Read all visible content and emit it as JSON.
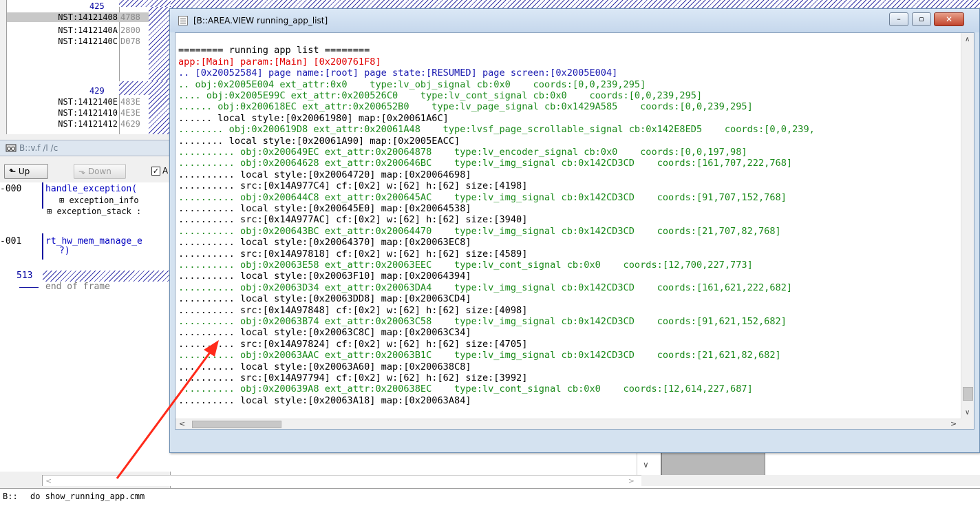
{
  "memory_dump": {
    "rows": [
      {
        "line": "425"
      },
      {
        "addr": "NST:14121408",
        "val": "4788",
        "highlight": true
      },
      {
        "addr": "NST:1412140A",
        "val": "2800"
      },
      {
        "addr": "NST:1412140C",
        "val": "D078"
      },
      {
        "line": "429"
      },
      {
        "addr": "NST:1412140E",
        "val": "483E"
      },
      {
        "addr": "NST:14121410",
        "val": "4E3E"
      },
      {
        "addr": "NST:14121412",
        "val": "4629"
      }
    ]
  },
  "frame_window": {
    "title": "B::v.f /l /c",
    "up_label": "Up",
    "down_label": "Down",
    "checkbox_label": "A",
    "checkbox_checked": "✓",
    "frames": [
      {
        "level": "-000",
        "func": "handle_exception(",
        "children": [
          "⊞ exception_info",
          "⊞ exception_stack :"
        ]
      },
      {
        "level": "-001",
        "func": "rt_hw_mem_manage_e",
        "tail": "?)"
      }
    ],
    "end_line": "513",
    "end_text": "end of frame"
  },
  "area_window": {
    "title": "[B::AREA.VIEW running_app_list]",
    "lines": [
      {
        "c": "black",
        "t": ""
      },
      {
        "c": "black",
        "t": "======== running app list ========"
      },
      {
        "c": "red",
        "t": "app:[Main] param:[Main] [0x200761F8]"
      },
      {
        "c": "blue",
        "t": ".. [0x20052584] page name:[root] page state:[RESUMED] page screen:[0x2005E004]"
      },
      {
        "c": "green",
        "t": ".. obj:0x2005E004 ext_attr:0x0    type:lv_obj_signal cb:0x0    coords:[0,0,239,295]"
      },
      {
        "c": "green",
        "t": ".... obj:0x2005E99C ext_attr:0x200526C0    type:lv_cont_signal cb:0x0    coords:[0,0,239,295]"
      },
      {
        "c": "green",
        "t": "...... obj:0x200618EC ext_attr:0x200652B0    type:lv_page_signal cb:0x1429A585    coords:[0,0,239,295]"
      },
      {
        "c": "black",
        "t": "...... local style:[0x20061980] map:[0x20061A6C]"
      },
      {
        "c": "green",
        "t": "........ obj:0x200619D8 ext_attr:0x20061A48    type:lvsf_page_scrollable_signal cb:0x142E8ED5    coords:[0,0,239,"
      },
      {
        "c": "black",
        "t": "........ local style:[0x20061A90] map:[0x2005EACC]"
      },
      {
        "c": "green",
        "t": ".......... obj:0x200649EC ext_attr:0x20064878    type:lv_encoder_signal cb:0x0    coords:[0,0,197,98]"
      },
      {
        "c": "green",
        "t": ".......... obj:0x20064628 ext_attr:0x200646BC    type:lv_img_signal cb:0x142CD3CD    coords:[161,707,222,768]"
      },
      {
        "c": "black",
        "t": ".......... local style:[0x20064720] map:[0x20064698]"
      },
      {
        "c": "black",
        "t": ".......... src:[0x14A977C4] cf:[0x2] w:[62] h:[62] size:[4198]"
      },
      {
        "c": "green",
        "t": ".......... obj:0x200644C8 ext_attr:0x200645AC    type:lv_img_signal cb:0x142CD3CD    coords:[91,707,152,768]"
      },
      {
        "c": "black",
        "t": ".......... local style:[0x200645E0] map:[0x20064538]"
      },
      {
        "c": "black",
        "t": ".......... src:[0x14A977AC] cf:[0x2] w:[62] h:[62] size:[3940]"
      },
      {
        "c": "green",
        "t": ".......... obj:0x200643BC ext_attr:0x20064470    type:lv_img_signal cb:0x142CD3CD    coords:[21,707,82,768]"
      },
      {
        "c": "black",
        "t": ".......... local style:[0x20064370] map:[0x20063EC8]"
      },
      {
        "c": "black",
        "t": ".......... src:[0x14A97818] cf:[0x2] w:[62] h:[62] size:[4589]"
      },
      {
        "c": "green",
        "t": ".......... obj:0x20063E58 ext_attr:0x20063EEC    type:lv_cont_signal cb:0x0    coords:[12,700,227,773]"
      },
      {
        "c": "black",
        "t": ".......... local style:[0x20063F10] map:[0x20064394]"
      },
      {
        "c": "green",
        "t": ".......... obj:0x20063D34 ext_attr:0x20063DA4    type:lv_img_signal cb:0x142CD3CD    coords:[161,621,222,682]"
      },
      {
        "c": "black",
        "t": ".......... local style:[0x20063DD8] map:[0x20063CD4]"
      },
      {
        "c": "black",
        "t": ".......... src:[0x14A97848] cf:[0x2] w:[62] h:[62] size:[4098]"
      },
      {
        "c": "green",
        "t": ".......... obj:0x20063B74 ext_attr:0x20063C58    type:lv_img_signal cb:0x142CD3CD    coords:[91,621,152,682]"
      },
      {
        "c": "black",
        "t": ".......... local style:[0x20063C8C] map:[0x20063C34]"
      },
      {
        "c": "black",
        "t": ".......... src:[0x14A97824] cf:[0x2] w:[62] h:[62] size:[4705]"
      },
      {
        "c": "green",
        "t": ".......... obj:0x20063AAC ext_attr:0x20063B1C    type:lv_img_signal cb:0x142CD3CD    coords:[21,621,82,682]"
      },
      {
        "c": "black",
        "t": ".......... local style:[0x20063A60] map:[0x200638C8]"
      },
      {
        "c": "black",
        "t": ".......... src:[0x14A97794] cf:[0x2] w:[62] h:[62] size:[3992]"
      },
      {
        "c": "green",
        "t": ".......... obj:0x200639A8 ext_attr:0x200638EC    type:lv_cont_signal cb:0x0    coords:[12,614,227,687]"
      },
      {
        "c": "black",
        "t": ".......... local style:[0x20063A18] map:[0x20063A84]"
      }
    ]
  },
  "command_line": {
    "prompt": "B::",
    "command": "do show_running_app.cmm"
  },
  "colors": {
    "red": "#e00000",
    "blue": "#1a1ab0",
    "green": "#1a8a1a",
    "annotation_arrow": "#ff2a1a"
  }
}
